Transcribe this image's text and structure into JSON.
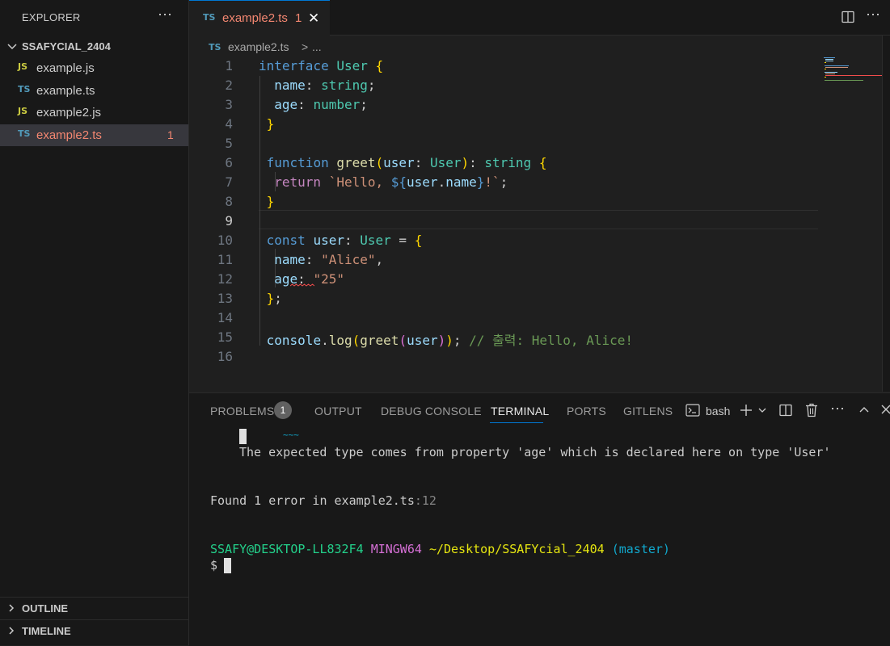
{
  "sidebar": {
    "title": "EXPLORER",
    "more_icon": "⋯",
    "project": "SSAFYCIAL_2404",
    "files": [
      {
        "badge_type": "JS",
        "name": "example.js"
      },
      {
        "badge_type": "TS",
        "name": "example.ts"
      },
      {
        "badge_type": "JS",
        "name": "example2.js"
      },
      {
        "badge_type": "TS",
        "name": "example2.ts",
        "problems": "1"
      }
    ],
    "sections": [
      "OUTLINE",
      "TIMELINE"
    ]
  },
  "tab": {
    "icon": "TS",
    "label": "example2.ts",
    "badge": "1",
    "close": "✕"
  },
  "breadcrumb": {
    "icon": "TS",
    "file": "example2.ts",
    "sep": ">",
    "more": "..."
  },
  "editor": {
    "line_numbers": [
      "1",
      "2",
      "3",
      "4",
      "5",
      "6",
      "7",
      "8",
      "9",
      "10",
      "11",
      "12",
      "13",
      "14",
      "15",
      "16"
    ],
    "active_line": "9"
  },
  "panel": {
    "tabs": [
      "PROBLEMS",
      "OUTPUT",
      "DEBUG CONSOLE",
      "TERMINAL",
      "PORTS",
      "GITLENS"
    ],
    "problems_count": "1",
    "active_tab": "TERMINAL",
    "shell": "bash"
  },
  "terminal": {
    "squiggle": "~~~",
    "expected_msg": "The expected type comes from property 'age' which is declared here on type 'User'",
    "found_prefix": "Found 1 error in example2.ts",
    "found_suffix": ":12",
    "prompt_user": "SSAFY@DESKTOP-LL832F4",
    "prompt_env": "MINGW64",
    "prompt_path": "~/Desktop/SSAFYcial_2404",
    "prompt_branch": "(master)",
    "prompt_symbol": "$"
  },
  "colors": {
    "accent": "#0078d4",
    "error": "#f48771",
    "js_badge": "#cbcb41",
    "ts_badge": "#519aba"
  }
}
